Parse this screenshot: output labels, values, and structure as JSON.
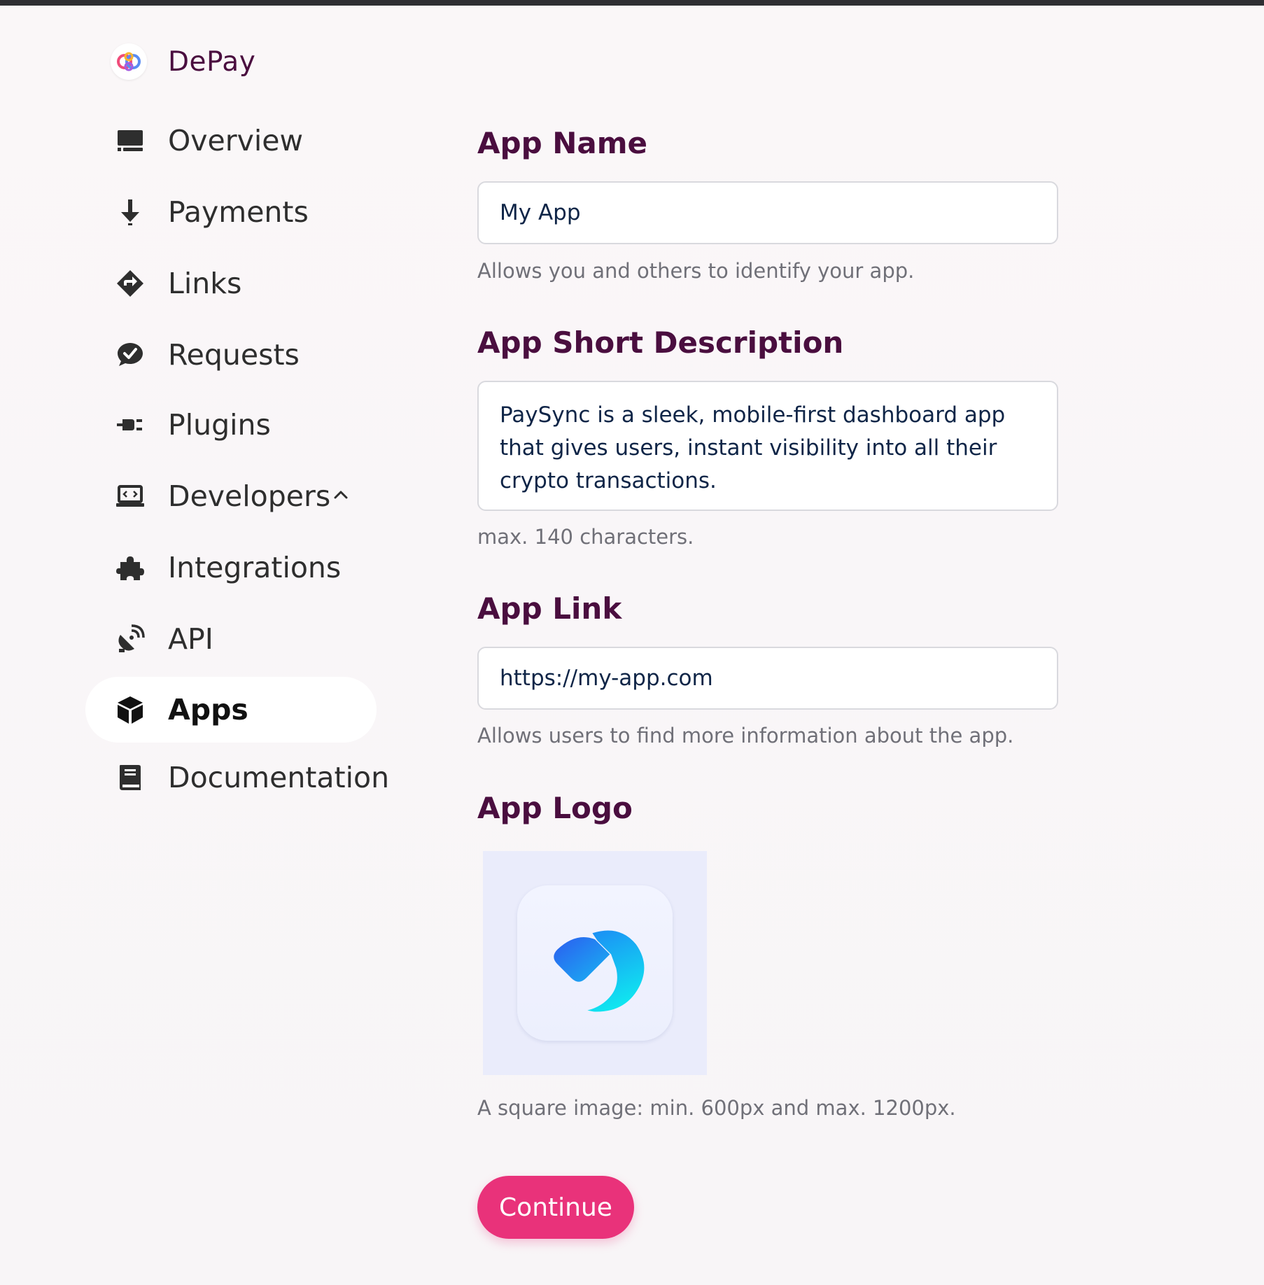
{
  "brand": {
    "name": "DePay",
    "logo_icon": "depay-logo-icon"
  },
  "sidebar": {
    "items": [
      {
        "label": "Overview",
        "icon": "monitor-icon",
        "active": false
      },
      {
        "label": "Payments",
        "icon": "arrow-down-icon",
        "active": false
      },
      {
        "label": "Links",
        "icon": "diamond-arrow-icon",
        "active": false
      },
      {
        "label": "Requests",
        "icon": "chat-check-icon",
        "active": false
      },
      {
        "label": "Plugins",
        "icon": "plug-icon",
        "active": false
      },
      {
        "label": "Developers",
        "icon": "laptop-code-icon",
        "active": false,
        "expanded": true
      },
      {
        "label": "Integrations",
        "icon": "puzzle-icon",
        "active": false
      },
      {
        "label": "API",
        "icon": "satellite-dish-icon",
        "active": false
      },
      {
        "label": "Apps",
        "icon": "cube-icon",
        "active": true
      },
      {
        "label": "Documentation",
        "icon": "book-icon",
        "active": false
      }
    ]
  },
  "form": {
    "app_name": {
      "title": "App Name",
      "value": "My App",
      "hint": "Allows you and others to identify your app."
    },
    "app_description": {
      "title": "App Short Description",
      "value": "PaySync is a sleek, mobile-first dashboard app that gives users, instant visibility into all their crypto transactions.",
      "hint": "max. 140 characters."
    },
    "app_link": {
      "title": "App Link",
      "value": "https://my-app.com",
      "hint": "Allows users to find more information about the app."
    },
    "app_logo": {
      "title": "App Logo",
      "hint": "A square image: min. 600px and max. 1200px."
    },
    "continue_label": "Continue"
  },
  "colors": {
    "accent": "#e9327a",
    "heading": "#4a0e3f",
    "hint": "#707078",
    "input_text": "#0f2547"
  }
}
